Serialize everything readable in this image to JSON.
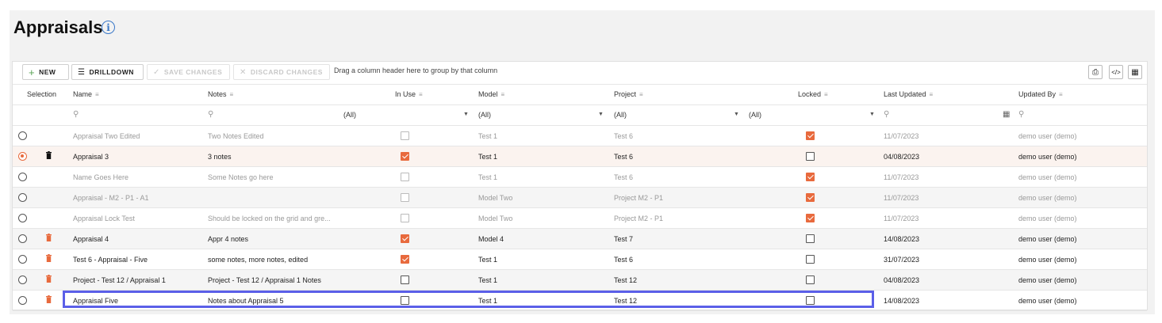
{
  "page": {
    "title": "Appraisals"
  },
  "toolbar": {
    "new_label": "NEW",
    "drilldown_label": "DRILLDOWN",
    "save_label": "SAVE CHANGES",
    "discard_label": "DISCARD CHANGES",
    "group_hint": "Drag a column header here to group by that column"
  },
  "columns": {
    "selection": "Selection",
    "name": "Name",
    "notes": "Notes",
    "in_use": "In Use",
    "model": "Model",
    "project": "Project",
    "locked": "Locked",
    "last_updated": "Last Updated",
    "updated_by": "Updated By"
  },
  "filters": {
    "in_use": "(All)",
    "model": "(All)",
    "project": "(All)",
    "locked": "(All)"
  },
  "rows": [
    {
      "name": "Appraisal Two Edited",
      "notes": "Two Notes Edited",
      "in_use": false,
      "model": "Test 1",
      "project": "Test 6",
      "locked": true,
      "last_updated": "11/07/2023",
      "updated_by": "demo user (demo)",
      "selected": false,
      "trash": "none",
      "dim": true
    },
    {
      "name": "Appraisal 3",
      "notes": "3 notes",
      "in_use": true,
      "model": "Test 1",
      "project": "Test 6",
      "locked": false,
      "last_updated": "04/08/2023",
      "updated_by": "demo user (demo)",
      "selected": true,
      "trash": "black",
      "dim": false
    },
    {
      "name": "Name Goes Here",
      "notes": "Some Notes go here",
      "in_use": false,
      "model": "Test 1",
      "project": "Test 6",
      "locked": true,
      "last_updated": "11/07/2023",
      "updated_by": "demo user (demo)",
      "selected": false,
      "trash": "none",
      "dim": true
    },
    {
      "name": "Appraisal - M2 - P1 - A1",
      "notes": "",
      "in_use": false,
      "model": "Model Two",
      "project": "Project M2 - P1",
      "locked": true,
      "last_updated": "11/07/2023",
      "updated_by": "demo user (demo)",
      "selected": false,
      "trash": "none",
      "dim": true
    },
    {
      "name": "Appraisal Lock Test",
      "notes": "Should be locked on the grid and gre...",
      "in_use": false,
      "model": "Model Two",
      "project": "Project M2 - P1",
      "locked": true,
      "last_updated": "11/07/2023",
      "updated_by": "demo user (demo)",
      "selected": false,
      "trash": "none",
      "dim": true
    },
    {
      "name": "Appraisal 4",
      "notes": "Appr 4 notes",
      "in_use": true,
      "model": "Model 4",
      "project": "Test 7",
      "locked": false,
      "last_updated": "14/08/2023",
      "updated_by": "demo user (demo)",
      "selected": false,
      "trash": "orange",
      "dim": false
    },
    {
      "name": "Test 6 - Appraisal - Five",
      "notes": "some notes, more notes, edited",
      "in_use": true,
      "model": "Test 1",
      "project": "Test 6",
      "locked": false,
      "last_updated": "31/07/2023",
      "updated_by": "demo user (demo)",
      "selected": false,
      "trash": "orange",
      "dim": false
    },
    {
      "name": "Project - Test 12 / Appraisal 1",
      "notes": "Project - Test 12 / Appraisal 1 Notes",
      "in_use": false,
      "model": "Test 1",
      "project": "Test 12",
      "locked": false,
      "last_updated": "04/08/2023",
      "updated_by": "demo user (demo)",
      "selected": false,
      "trash": "orange",
      "dim": false
    },
    {
      "name": "Appraisal Five",
      "notes": "Notes about Appraisal 5",
      "in_use": false,
      "model": "Test 1",
      "project": "Test 12",
      "locked": false,
      "last_updated": "14/08/2023",
      "updated_by": "demo user (demo)",
      "selected": false,
      "trash": "orange",
      "dim": false
    }
  ],
  "colors": {
    "accent": "#e86a3d",
    "highlight": "#5b5fe8",
    "info": "#3a78c8",
    "new_plus": "#5aa356"
  }
}
